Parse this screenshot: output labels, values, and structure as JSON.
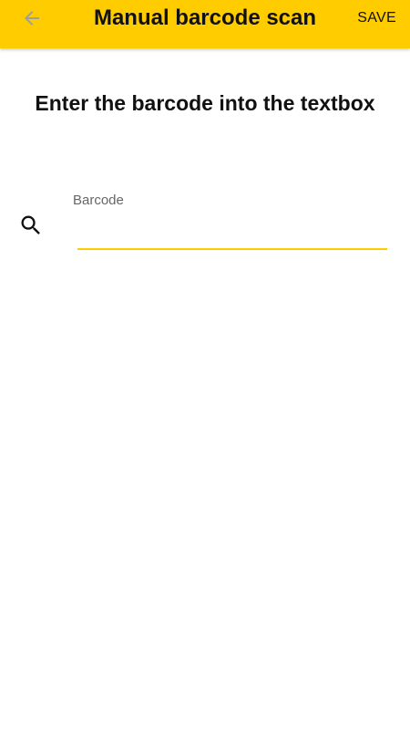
{
  "header": {
    "title": "Manual barcode scan",
    "save_label": "SAVE",
    "back_icon": "arrow-left-icon"
  },
  "main": {
    "instruction": "Enter the barcode into the textbox",
    "search_icon": "search-icon",
    "barcode_field": {
      "label": "Barcode",
      "value": ""
    }
  },
  "colors": {
    "accent": "#ffcc00",
    "text": "#111111",
    "label": "#666666",
    "back_icon": "#9e9e9e"
  }
}
